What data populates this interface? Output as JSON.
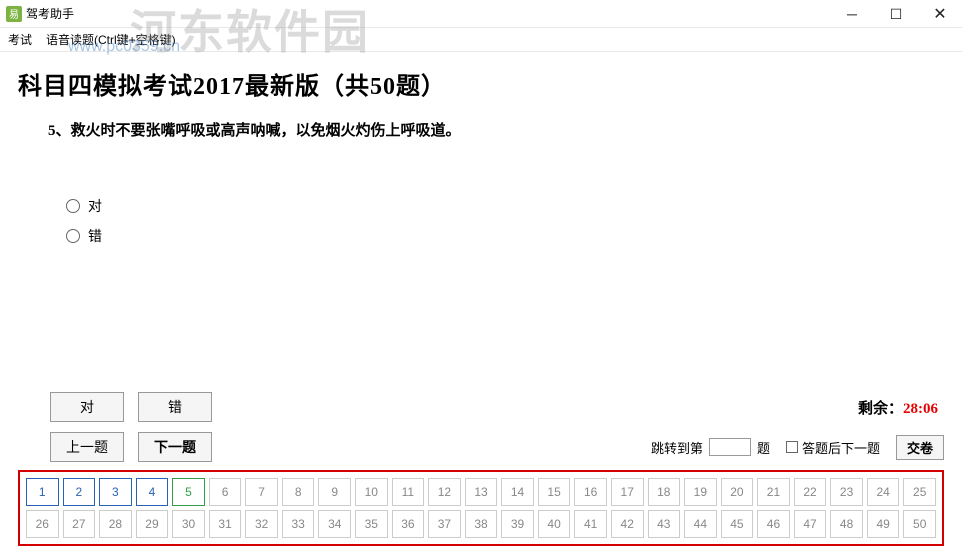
{
  "window": {
    "title": "驾考助手"
  },
  "menu": {
    "exam": "考试",
    "voice": "语音读题(Ctrl键+空格键)"
  },
  "watermark": {
    "text": "河东软件园",
    "url": "www.pc0359.cn"
  },
  "exam": {
    "title": "科目四模拟考试2017最新版（共50题）",
    "question_number": "5、",
    "question_text": "救火时不要张嘴呼吸或高声呐喊，以免烟火灼伤上呼吸道。",
    "options": [
      {
        "label": "对"
      },
      {
        "label": "错"
      }
    ]
  },
  "controls": {
    "answer_true": "对",
    "answer_false": "错",
    "prev": "上一题",
    "next": "下一题",
    "jump_label1": "跳转到第",
    "jump_label2": "题",
    "auto_next": "答题后下一题",
    "submit": "交卷"
  },
  "timer": {
    "label": "剩余：",
    "value": "28:06"
  },
  "grid": {
    "total": 50,
    "answered": [
      1,
      2,
      3,
      4
    ],
    "current": 5
  }
}
